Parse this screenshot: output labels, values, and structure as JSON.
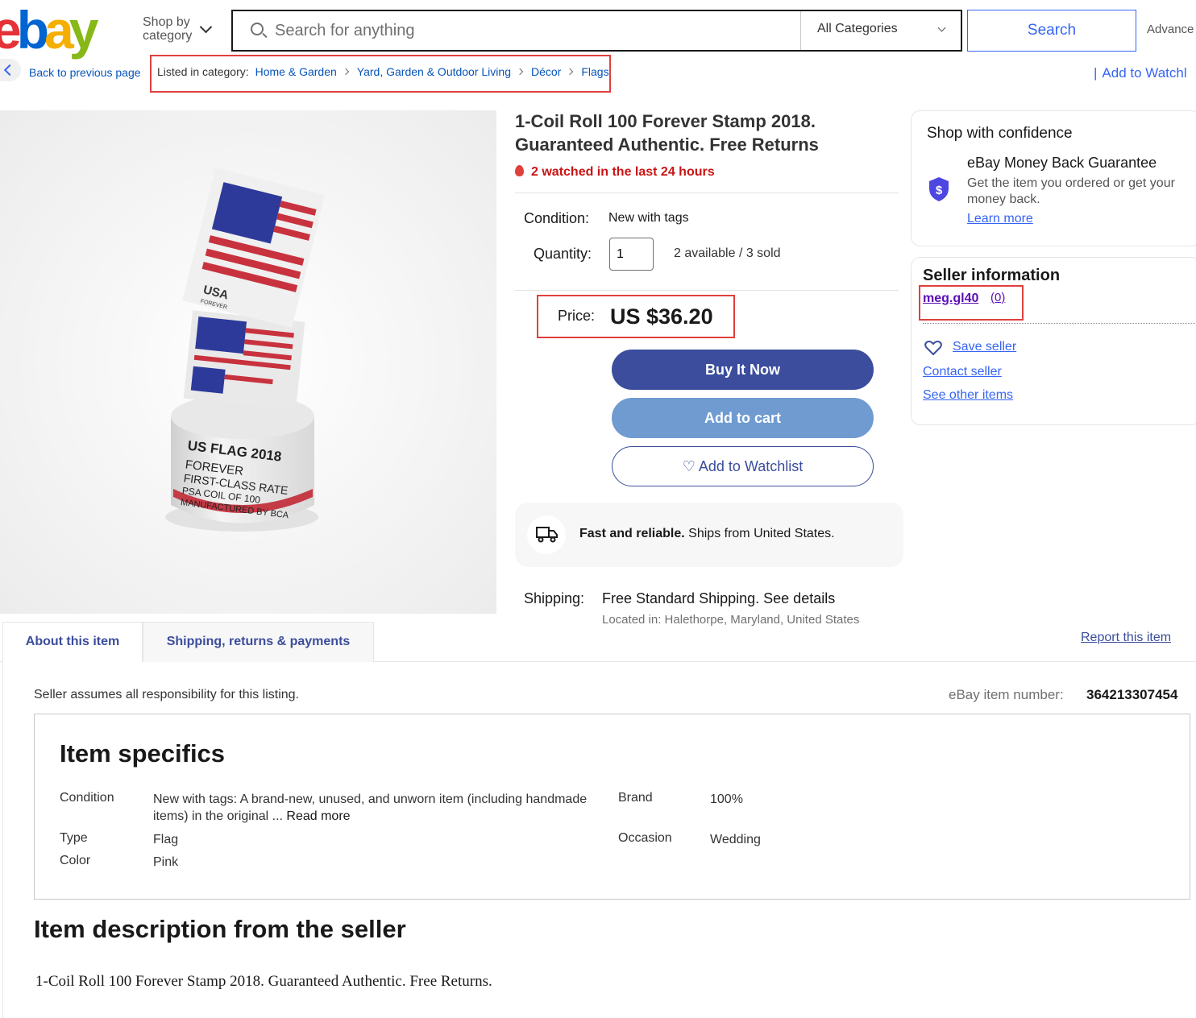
{
  "header": {
    "logo_letters": [
      "e",
      "b",
      "a",
      "y"
    ],
    "shop_by_category": "Shop by category",
    "search_placeholder": "Search for anything",
    "category_select": "All Categories",
    "search_button": "Search",
    "advanced": "Advance"
  },
  "breadcrumb": {
    "back": "Back to previous page",
    "listed_in": "Listed in category:",
    "items": [
      "Home & Garden",
      "Yard, Garden & Outdoor Living",
      "Décor",
      "Flags"
    ],
    "add_to_watchlist": "Add to Watchl"
  },
  "product": {
    "title": "1-Coil Roll 100 Forever Stamp 2018. Guaranteed Authentic. Free Returns",
    "watched": "2 watched in the last 24 hours",
    "condition_label": "Condition:",
    "condition_value": "New with tags",
    "quantity_label": "Quantity:",
    "quantity_value": "1",
    "availability": "2 available / 3 sold",
    "price_label": "Price:",
    "price_value": "US $36.20",
    "buy_now": "Buy It Now",
    "add_to_cart": "Add to cart",
    "add_to_watchlist": "Add to Watchlist",
    "fast_bold": "Fast and reliable.",
    "fast_rest": " Ships from United States.",
    "shipping_label": "Shipping:",
    "shipping_value": "Free Standard Shipping.",
    "see_details": "See details",
    "located": "Located in: Halethorpe, Maryland, United States",
    "image_text": {
      "usa": "USA",
      "forever": "FOREVER",
      "roll_line1": "US FLAG 2018",
      "roll_line2": "FOREVER",
      "roll_line3": "FIRST-CLASS RATE",
      "roll_line4": "PSA COIL OF 100",
      "roll_line5": "MANUFACTURED BY BCA"
    }
  },
  "confidence": {
    "heading": "Shop with confidence",
    "guarantee_title": "eBay Money Back Guarantee",
    "guarantee_text": "Get the item you ordered or get your money back.",
    "learn_more": "Learn more"
  },
  "seller": {
    "heading": "Seller information",
    "name": "meg.gl40",
    "feedback": "(0)",
    "save_seller": "Save seller",
    "contact_seller": "Contact seller",
    "see_other_items": "See other items"
  },
  "tabs": {
    "about": "About this item",
    "shipping": "Shipping, returns & payments",
    "report": "Report this item"
  },
  "details": {
    "responsibility": "Seller assumes all responsibility for this listing.",
    "item_number_label": "eBay item number:",
    "item_number": "364213307454",
    "specifics_heading": "Item specifics",
    "specifics": {
      "condition_key": "Condition",
      "condition_val": "New with tags: A brand-new, unused, and unworn item (including handmade items) in the original ...",
      "read_more": "Read more",
      "brand_key": "Brand",
      "brand_val": "100%",
      "type_key": "Type",
      "type_val": "Flag",
      "occasion_key": "Occasion",
      "occasion_val": "Wedding",
      "color_key": "Color",
      "color_val": "Pink"
    },
    "description_heading": "Item description from the seller",
    "description": "1-Coil Roll 100 Forever Stamp 2018. Guaranteed Authentic. Free Returns."
  },
  "colors": {
    "ebay_red": "#e53238",
    "ebay_blue": "#0064d2",
    "ebay_yellow": "#f5af02",
    "ebay_green": "#86b817",
    "buy_now": "#3b4d9c",
    "add_cart": "#6f9bd1",
    "highlight_box": "#e0403d"
  }
}
